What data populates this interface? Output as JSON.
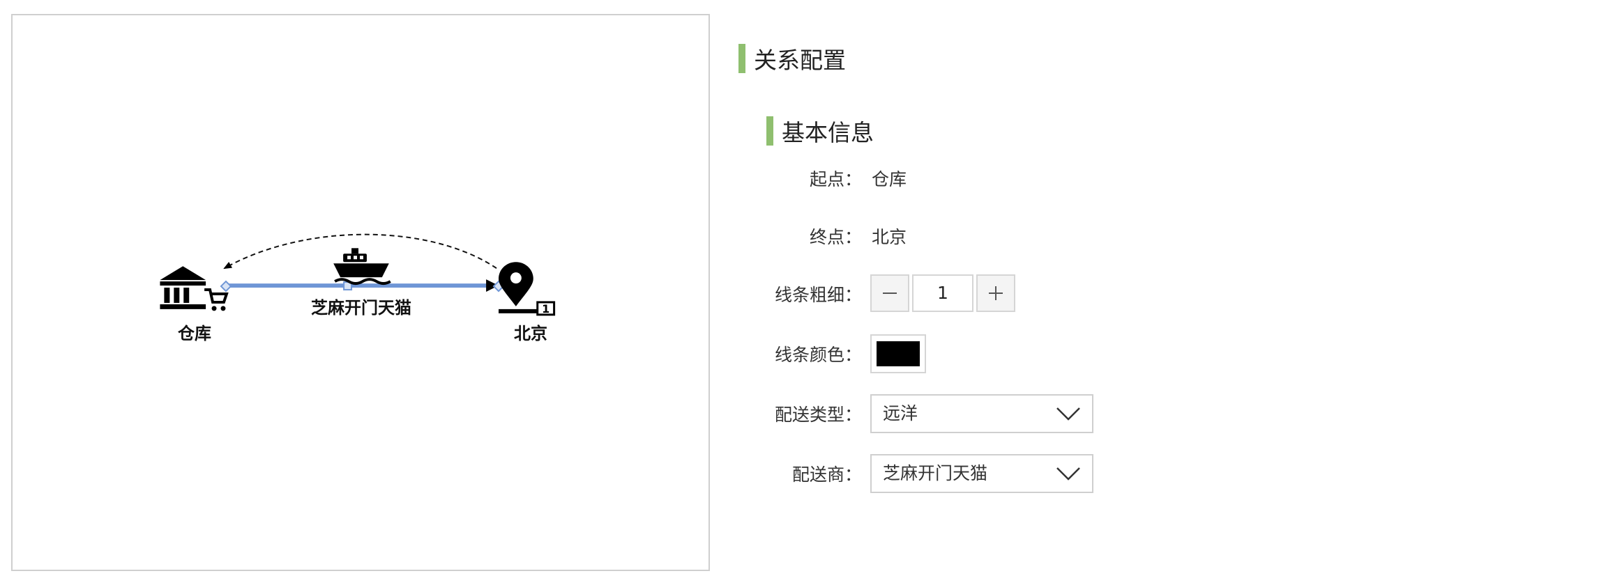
{
  "diagram": {
    "start_node": {
      "label": "仓库",
      "icon": "warehouse-icon"
    },
    "end_node": {
      "label": "北京",
      "icon": "location-pin-icon"
    },
    "edge": {
      "label": "芝麻开门天猫",
      "icon": "ship-icon",
      "color": "#6f96d6"
    }
  },
  "panel": {
    "title": "关系配置",
    "section_title": "基本信息",
    "accent_color": "#8fbf6f",
    "start": {
      "label": "起点：",
      "value": "仓库"
    },
    "end": {
      "label": "终点：",
      "value": "北京"
    },
    "line_width": {
      "label": "线条粗细：",
      "value": "1",
      "decrement_icon": "minus-icon",
      "increment_icon": "plus-icon"
    },
    "line_color": {
      "label": "线条颜色：",
      "value": "#000000"
    },
    "delivery_type": {
      "label": "配送类型：",
      "value": "远洋",
      "icon": "chevron-down-icon"
    },
    "carrier": {
      "label": "配送商：",
      "value": "芝麻开门天猫",
      "icon": "chevron-down-icon"
    }
  }
}
